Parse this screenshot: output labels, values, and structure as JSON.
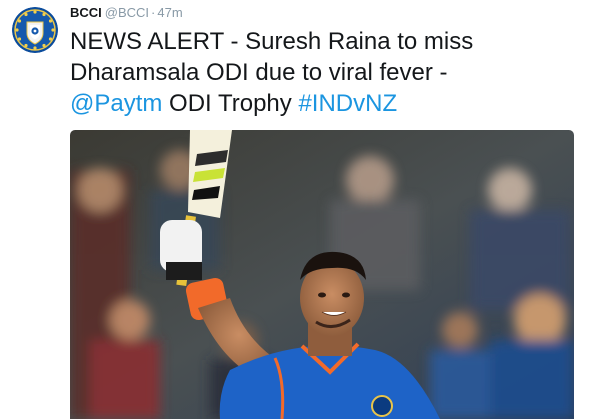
{
  "tweet": {
    "author": {
      "display_name": "BCCI",
      "handle": "@BCCI",
      "avatar_icon": "bcci-crest-logo"
    },
    "separator": "·",
    "timestamp": "47m",
    "text": {
      "line_main": "NEWS ALERT - Suresh Raina to miss Dharamsala ODI due to viral fever -",
      "mention": "@Paytm",
      "middle": " ODI Trophy ",
      "hashtag": "#INDvNZ"
    },
    "media": {
      "kind": "photo"
    }
  },
  "colors": {
    "name": "#14171a",
    "meta": "#8899a6",
    "link": "#1b95e0",
    "jersey_blue": "#1e63c7",
    "jersey_orange": "#f26a2a"
  }
}
